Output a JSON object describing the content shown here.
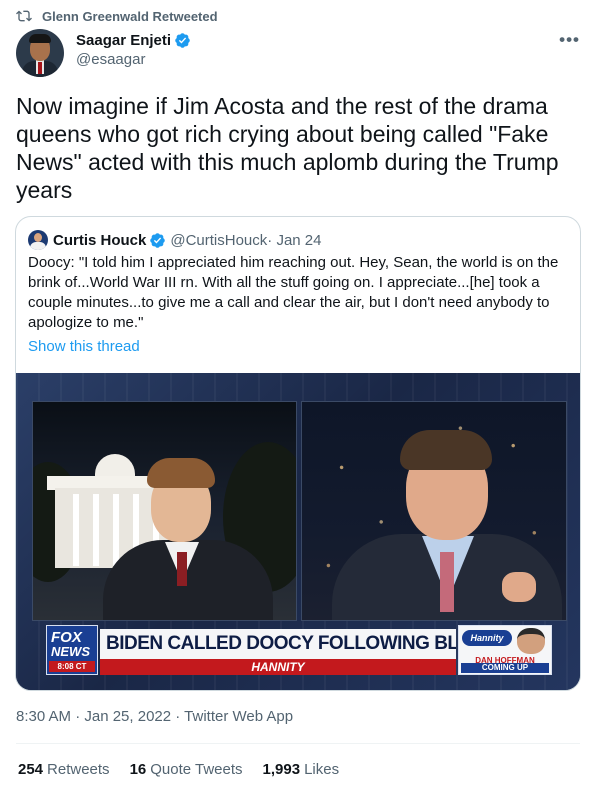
{
  "retweet": {
    "icon": "retweet-icon",
    "label": "Glenn Greenwald Retweeted"
  },
  "tweet": {
    "author": {
      "display_name": "Saagar Enjeti",
      "handle": "@esaagar",
      "verified": true
    },
    "more_icon": "more-icon",
    "text": "Now imagine if Jim Acosta and the rest of the drama queens who got rich crying about being called \"Fake News\" acted with this much aplomb during the Trump years",
    "timestamp": "8:30 AM · Jan 25, 2022 · Twitter Web App"
  },
  "quote": {
    "author": {
      "display_name": "Curtis Houck",
      "handle": "@CurtisHouck",
      "date": " · Jan 24",
      "verified": true
    },
    "text": "Doocy: \"I told him I appreciated him reaching out. Hey, Sean, the world is on the brink of...World War III rn. With all the stuff going on. I appreciate...[he] took a couple minutes...to give me a call and clear the air, but I don't need anybody to apologize to me.\"",
    "show_thread": "Show this thread",
    "media": {
      "network_line1": "FOX",
      "network_line2": "NEWS",
      "time": "8:08 CT",
      "headline": "BIDEN CALLED DOOCY FOLLOWING BLOW UP",
      "show_name": "HANNITY",
      "next_logo": "Hannity",
      "next_name": "DAN HOFFMAN",
      "next_label": "COMING UP"
    }
  },
  "stats": {
    "retweets": {
      "count": "254",
      "label": "Retweets"
    },
    "quote_tweets": {
      "count": "16",
      "label": "Quote Tweets"
    },
    "likes": {
      "count": "1,993",
      "label": "Likes"
    }
  },
  "colors": {
    "verified_blue": "#1d9bf0",
    "secondary_text": "#536471",
    "link": "#1d9bf0"
  }
}
